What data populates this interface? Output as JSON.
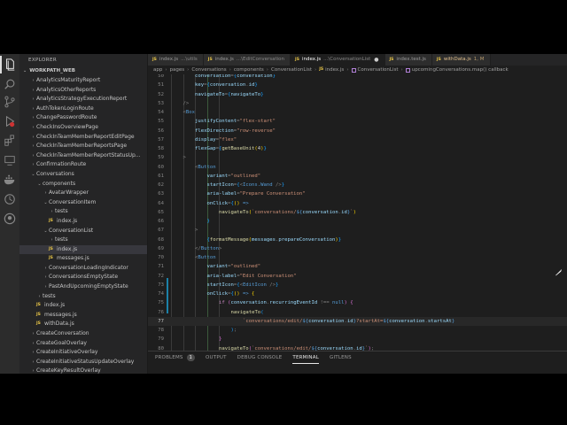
{
  "sidebar": {
    "title": "EXPLORER",
    "project": "WORKPATH_WEB",
    "items": [
      {
        "label": "AnalyticsMaturityReport",
        "indent": 3,
        "chev": "›"
      },
      {
        "label": "AnalyticsOtherReports",
        "indent": 3,
        "chev": "›"
      },
      {
        "label": "AnalyticsStrategyExecutionReport",
        "indent": 3,
        "chev": "›"
      },
      {
        "label": "AuthTokenLoginRoute",
        "indent": 3,
        "chev": "›"
      },
      {
        "label": "ChangePasswordRoute",
        "indent": 3,
        "chev": "›"
      },
      {
        "label": "CheckInsOverviewPage",
        "indent": 3,
        "chev": "›"
      },
      {
        "label": "CheckInTeamMemberReportEditPage",
        "indent": 3,
        "chev": "›"
      },
      {
        "label": "CheckInTeamMemberReportsPage",
        "indent": 3,
        "chev": "›"
      },
      {
        "label": "CheckInTeamMemberReportStatusUp...",
        "indent": 3,
        "chev": "›"
      },
      {
        "label": "ConfirmationRoute",
        "indent": 3,
        "chev": "›"
      },
      {
        "label": "Conversations",
        "indent": 3,
        "chev": "⌄"
      },
      {
        "label": "components",
        "indent": 4,
        "chev": "⌄"
      },
      {
        "label": "AvatarWrapper",
        "indent": 5,
        "chev": "›"
      },
      {
        "label": "ConversationItem",
        "indent": 5,
        "chev": "⌄"
      },
      {
        "label": "tests",
        "indent": 6,
        "chev": "›"
      },
      {
        "label": "index.js",
        "indent": 6,
        "js": true
      },
      {
        "label": "ConversationList",
        "indent": 5,
        "chev": "⌄"
      },
      {
        "label": "tests",
        "indent": 6,
        "chev": "›"
      },
      {
        "label": "index.js",
        "indent": 6,
        "js": true,
        "selected": true
      },
      {
        "label": "messages.js",
        "indent": 6,
        "js": true
      },
      {
        "label": "ConversationLoadingIndicator",
        "indent": 5,
        "chev": "›"
      },
      {
        "label": "ConversationsEmptyState",
        "indent": 5,
        "chev": "›"
      },
      {
        "label": "PastAndUpcomingEmptyState",
        "indent": 5,
        "chev": "›"
      },
      {
        "label": "tests",
        "indent": 4,
        "chev": "›"
      },
      {
        "label": "index.js",
        "indent": 4,
        "js": true
      },
      {
        "label": "messages.js",
        "indent": 4,
        "js": true
      },
      {
        "label": "withData.js",
        "indent": 4,
        "js": true
      },
      {
        "label": "CreateConversation",
        "indent": 3,
        "chev": "›"
      },
      {
        "label": "CreateGoalOverlay",
        "indent": 3,
        "chev": "›"
      },
      {
        "label": "CreateInitiativeOverlay",
        "indent": 3,
        "chev": "›"
      },
      {
        "label": "CreateInitiativeStatusUpdateOverlay",
        "indent": 3,
        "chev": "›"
      },
      {
        "label": "CreateKeyResultOverlay",
        "indent": 3,
        "chev": "›"
      }
    ]
  },
  "tabs": [
    {
      "icon": "JS",
      "label": "index.js",
      "desc": "...\\utils",
      "active": false
    },
    {
      "icon": "JS",
      "label": "index.js",
      "desc": "...\\EditConversation",
      "active": false
    },
    {
      "icon": "JS",
      "label": "index.js",
      "desc": "...\\ConversationList",
      "active": true,
      "dot": "●"
    },
    {
      "icon": "JS",
      "label": "index.test.js",
      "desc": "",
      "active": false
    },
    {
      "icon": "JS",
      "label": "withData.js",
      "desc": "1, M",
      "active": false,
      "modified": true
    }
  ],
  "breadcrumb": [
    "app",
    "pages",
    "Conversations",
    "components",
    "ConversationList",
    "index.js",
    "ConversationList",
    "upcomingConversations.map() callback"
  ],
  "editor": {
    "current_line": 77,
    "lines": [
      {
        "n": 50,
        "i": 6,
        "tokens": [
          [
            "a",
            "conversation"
          ],
          [
            "p",
            "="
          ],
          [
            "b3",
            "{"
          ],
          [
            "a",
            "conversation"
          ],
          [
            "b3",
            "}"
          ]
        ]
      },
      {
        "n": 51,
        "i": 6,
        "tokens": [
          [
            "a",
            "key"
          ],
          [
            "p",
            "="
          ],
          [
            "b3",
            "{"
          ],
          [
            "a",
            "conversation"
          ],
          [
            "p",
            "."
          ],
          [
            "a",
            "id"
          ],
          [
            "b3",
            "}"
          ]
        ]
      },
      {
        "n": 52,
        "i": 6,
        "tokens": [
          [
            "a",
            "navigateTo"
          ],
          [
            "p",
            "="
          ],
          [
            "b3",
            "{"
          ],
          [
            "a",
            "navigateTo"
          ],
          [
            "b3",
            "}"
          ]
        ]
      },
      {
        "n": 53,
        "i": 5,
        "tokens": [
          [
            "p",
            "/>"
          ]
        ]
      },
      {
        "n": 54,
        "i": 5,
        "tokens": [
          [
            "p",
            "<"
          ],
          [
            "t",
            "Box"
          ]
        ]
      },
      {
        "n": 55,
        "i": 6,
        "tokens": [
          [
            "a",
            "justifyContent"
          ],
          [
            "p",
            "="
          ],
          [
            "s",
            "\"flex-start\""
          ]
        ]
      },
      {
        "n": 56,
        "i": 6,
        "tokens": [
          [
            "a",
            "flexDirection"
          ],
          [
            "p",
            "="
          ],
          [
            "s",
            "\"row-reverse\""
          ]
        ]
      },
      {
        "n": 57,
        "i": 6,
        "tokens": [
          [
            "a",
            "display"
          ],
          [
            "p",
            "="
          ],
          [
            "s",
            "\"flex\""
          ]
        ]
      },
      {
        "n": 58,
        "i": 6,
        "tokens": [
          [
            "a",
            "flexGap"
          ],
          [
            "p",
            "="
          ],
          [
            "b3",
            "{"
          ],
          [
            "f",
            "getBaseUnit"
          ],
          [
            "b1",
            "("
          ],
          [
            "n",
            "4"
          ],
          [
            "b1",
            ")"
          ],
          [
            "b3",
            "}"
          ]
        ]
      },
      {
        "n": 59,
        "i": 5,
        "tokens": [
          [
            "p",
            ">"
          ]
        ]
      },
      {
        "n": 60,
        "i": 6,
        "tokens": [
          [
            "p",
            "<"
          ],
          [
            "t",
            "Button"
          ]
        ]
      },
      {
        "n": 61,
        "i": 7,
        "tokens": [
          [
            "a",
            "variant"
          ],
          [
            "p",
            "="
          ],
          [
            "s",
            "\"outlined\""
          ]
        ]
      },
      {
        "n": 62,
        "i": 7,
        "tokens": [
          [
            "a",
            "startIcon"
          ],
          [
            "p",
            "="
          ],
          [
            "b3",
            "{"
          ],
          [
            "p",
            "<"
          ],
          [
            "t",
            "Icons.Wand"
          ],
          [
            "p",
            " />"
          ],
          [
            "b3",
            "}"
          ]
        ]
      },
      {
        "n": 63,
        "i": 7,
        "tokens": [
          [
            "a",
            "aria-label"
          ],
          [
            "p",
            "="
          ],
          [
            "s",
            "\"Prepare Conversation\""
          ]
        ]
      },
      {
        "n": 64,
        "i": 7,
        "tokens": [
          [
            "a",
            "onClick"
          ],
          [
            "p",
            "="
          ],
          [
            "b3",
            "{"
          ],
          [
            "b1",
            "()"
          ],
          [
            "t",
            " =>"
          ]
        ]
      },
      {
        "n": 65,
        "i": 8,
        "tokens": [
          [
            "f",
            "navigateTo"
          ],
          [
            "b1",
            "("
          ],
          [
            "s",
            "`conversations/"
          ],
          [
            "t",
            "${"
          ],
          [
            "a",
            "conversation"
          ],
          [
            "p",
            "."
          ],
          [
            "a",
            "id"
          ],
          [
            "t",
            "}"
          ],
          [
            "s",
            "`"
          ],
          [
            "b1",
            ")"
          ]
        ]
      },
      {
        "n": 66,
        "i": 7,
        "tokens": [
          [
            "b3",
            "}"
          ]
        ]
      },
      {
        "n": 67,
        "i": 6,
        "tokens": [
          [
            "p",
            ">"
          ]
        ]
      },
      {
        "n": 68,
        "i": 7,
        "tokens": [
          [
            "b3",
            "{"
          ],
          [
            "f",
            "formatMessage"
          ],
          [
            "b1",
            "("
          ],
          [
            "a",
            "messages"
          ],
          [
            "p",
            "."
          ],
          [
            "a",
            "prepareConversation"
          ],
          [
            "b1",
            ")"
          ],
          [
            "b3",
            "}"
          ]
        ]
      },
      {
        "n": 69,
        "i": 6,
        "tokens": [
          [
            "p",
            "</"
          ],
          [
            "t",
            "Button"
          ],
          [
            "p",
            ">"
          ]
        ]
      },
      {
        "n": 70,
        "i": 6,
        "tokens": [
          [
            "p",
            "<"
          ],
          [
            "t",
            "Button"
          ]
        ]
      },
      {
        "n": 71,
        "i": 7,
        "tokens": [
          [
            "a",
            "variant"
          ],
          [
            "p",
            "="
          ],
          [
            "s",
            "\"outlined\""
          ]
        ]
      },
      {
        "n": 72,
        "i": 7,
        "tokens": [
          [
            "a",
            "aria-label"
          ],
          [
            "p",
            "="
          ],
          [
            "s",
            "\"Edit Conversation\""
          ]
        ]
      },
      {
        "n": 73,
        "i": 7,
        "tokens": [
          [
            "a",
            "startIcon"
          ],
          [
            "p",
            "="
          ],
          [
            "b3",
            "{"
          ],
          [
            "p",
            "<"
          ],
          [
            "t",
            "EditIcon"
          ],
          [
            "p",
            " />"
          ],
          [
            "b3",
            "}"
          ]
        ]
      },
      {
        "n": 74,
        "i": 7,
        "tokens": [
          [
            "a",
            "onClick"
          ],
          [
            "p",
            "="
          ],
          [
            "b3",
            "{"
          ],
          [
            "b1",
            "()"
          ],
          [
            "t",
            " =>"
          ],
          [
            "b1",
            " {"
          ]
        ]
      },
      {
        "n": 75,
        "i": 8,
        "tokens": [
          [
            "k",
            "if"
          ],
          [
            "b2",
            " ("
          ],
          [
            "a",
            "conversation"
          ],
          [
            "p",
            "."
          ],
          [
            "a",
            "recurringEventId"
          ],
          [
            "p",
            " !== "
          ],
          [
            "t",
            "null"
          ],
          [
            "b2",
            ")"
          ],
          [
            "b2",
            " {"
          ]
        ]
      },
      {
        "n": 76,
        "i": 9,
        "tokens": [
          [
            "f",
            "navigateTo"
          ],
          [
            "b3",
            "("
          ]
        ]
      },
      {
        "n": 77,
        "i": 10,
        "tokens": [
          [
            "s",
            "`conversations/edit/"
          ],
          [
            "t",
            "${"
          ],
          [
            "a",
            "conversation"
          ],
          [
            "p",
            "."
          ],
          [
            "a",
            "id"
          ],
          [
            "t",
            "}"
          ],
          [
            "s",
            "?startAt="
          ],
          [
            "t",
            "${"
          ],
          [
            "a",
            "conversation"
          ],
          [
            "p",
            "."
          ],
          [
            "a",
            "startsAt"
          ],
          [
            "t",
            "}"
          ]
        ]
      },
      {
        "n": 78,
        "i": 9,
        "tokens": [
          [
            "b3",
            ")"
          ],
          [
            "p",
            ";"
          ]
        ]
      },
      {
        "n": 79,
        "i": 8,
        "tokens": [
          [
            "b2",
            "}"
          ]
        ]
      },
      {
        "n": 80,
        "i": 8,
        "tokens": [
          [
            "f",
            "navigateTo"
          ],
          [
            "b2",
            "("
          ],
          [
            "s",
            "`conversations/edit/"
          ],
          [
            "t",
            "${"
          ],
          [
            "a",
            "conversation"
          ],
          [
            "p",
            "."
          ],
          [
            "a",
            "id"
          ],
          [
            "t",
            "}"
          ],
          [
            "s",
            "`"
          ],
          [
            "b2",
            ")"
          ],
          [
            "p",
            ";"
          ]
        ]
      },
      {
        "n": 81,
        "i": 7,
        "tokens": [
          [
            "b1",
            "}"
          ],
          [
            "b3",
            ")"
          ]
        ]
      },
      {
        "n": 82,
        "i": 6,
        "tokens": [
          [
            "p",
            ">"
          ]
        ]
      },
      {
        "n": 83,
        "i": 7,
        "tokens": [
          [
            "b3",
            "{"
          ],
          [
            "f",
            "formatMessage"
          ],
          [
            "b1",
            "("
          ],
          [
            "a",
            "messages"
          ],
          [
            "p",
            "."
          ],
          [
            "a",
            "editConversation"
          ],
          [
            "b1",
            ")"
          ],
          [
            "b3",
            "}"
          ]
        ]
      },
      {
        "n": 84,
        "i": 6,
        "tokens": [
          [
            "p",
            "</"
          ],
          [
            "t",
            "Button"
          ],
          [
            "p",
            ">"
          ]
        ]
      },
      {
        "n": 85,
        "i": 5,
        "tokens": [
          [
            "p",
            "</"
          ],
          [
            "t",
            "Box"
          ],
          [
            "p",
            ">"
          ]
        ]
      }
    ]
  },
  "panel": {
    "tabs": [
      {
        "label": "PROBLEMS",
        "badge": "1",
        "active": false
      },
      {
        "label": "OUTPUT",
        "active": false
      },
      {
        "label": "DEBUG CONSOLE",
        "active": false
      },
      {
        "label": "TERMINAL",
        "active": true
      },
      {
        "label": "GITLENS",
        "active": false
      }
    ]
  },
  "colors": {
    "accent": "#1b81a8",
    "js_icon": "#e8c547",
    "tag": "#569cd6",
    "attr": "#9cdcfe",
    "string": "#ce9178"
  },
  "activity_icons": [
    "files-icon",
    "search-icon",
    "source-control-icon",
    "run-debug-icon",
    "extensions-icon",
    "remote-explorer-icon",
    "docker-icon",
    "timeline-icon",
    "github-icon"
  ]
}
